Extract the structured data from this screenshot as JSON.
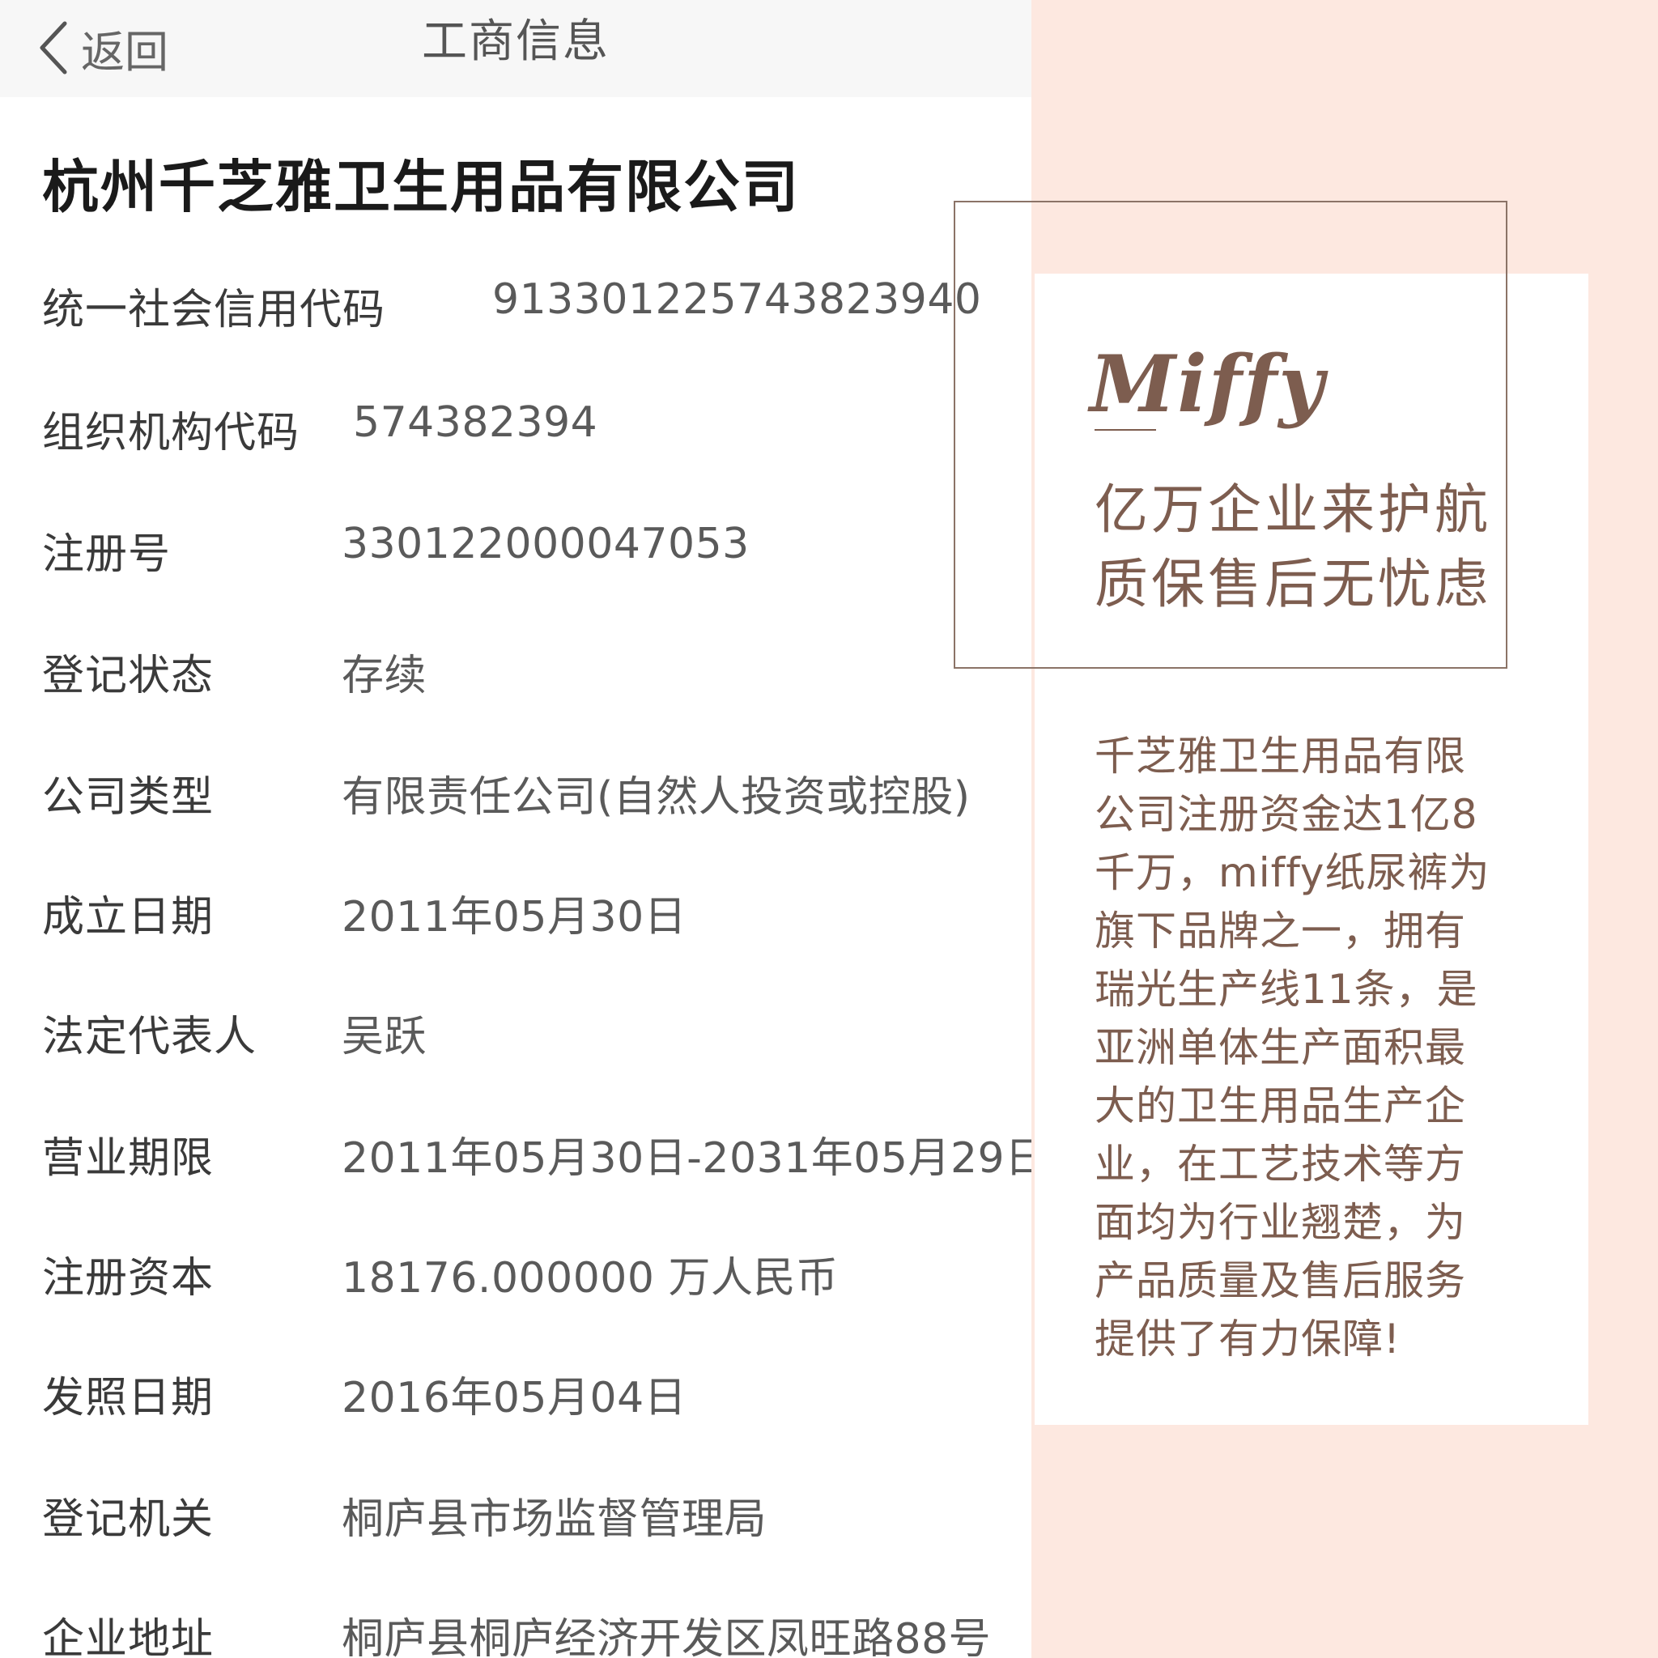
{
  "navbar": {
    "back_label": "返回",
    "title": "工商信息"
  },
  "company_name": "杭州千芝雅卫生用品有限公司",
  "info": [
    {
      "label": "统一社会信用代码",
      "value": "91330122574382394​0"
    },
    {
      "label": "组织机构代码",
      "value": "574382394"
    },
    {
      "label": "注册号",
      "value": "330122000047053"
    },
    {
      "label": "登记状态",
      "value": "存续"
    },
    {
      "label": "公司类型",
      "value": "有限责任公司(自然人投资或控股)"
    },
    {
      "label": "成立日期",
      "value": "2011年05月30日"
    },
    {
      "label": "法定代表人",
      "value": "吴跃"
    },
    {
      "label": "营业期限",
      "value": "2011年05月30日-2031年05月29日"
    },
    {
      "label": "注册资本",
      "value": "18176.000000 万人民币"
    },
    {
      "label": "发照日期",
      "value": "2016年05月04日"
    },
    {
      "label": "登记机关",
      "value": "桐庐县市场监督管理局"
    },
    {
      "label": "企业地址",
      "value": "桐庐县桐庐经济开发区凤旺路88号"
    }
  ],
  "promo": {
    "logo": "Miffy",
    "slogan_lines": [
      "亿万企业来护航",
      "质保售后无忧虑"
    ],
    "description_lines": [
      "千芝雅卫生用品有限",
      "公司注册资金达1亿8",
      "千万，miffy纸尿裤为",
      "旗下品牌之一，拥有",
      "瑞光生产线11条，是",
      "亚洲单体生产面积最",
      "大的卫生用品生产企",
      "业，在工艺技术等方",
      "面均为行业翘楚，为",
      "产品质量及售后服务",
      "提供了有力保障!"
    ],
    "colors": {
      "brand_brown": "#7d5d4f",
      "background_pink": "#fde8e0"
    }
  }
}
